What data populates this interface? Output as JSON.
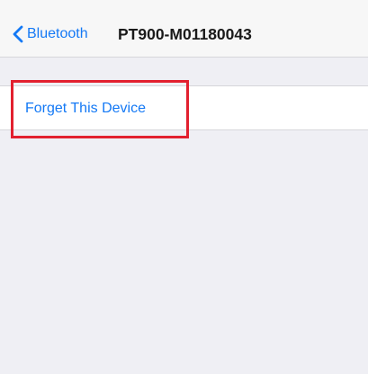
{
  "nav": {
    "back_label": "Bluetooth",
    "title": "PT900-M01180043",
    "back_icon": "chevron-left-icon"
  },
  "actions": {
    "forget_label": "Forget This Device"
  },
  "colors": {
    "accent": "#1479f5",
    "background": "#efeff4",
    "highlight": "#e2202f"
  }
}
